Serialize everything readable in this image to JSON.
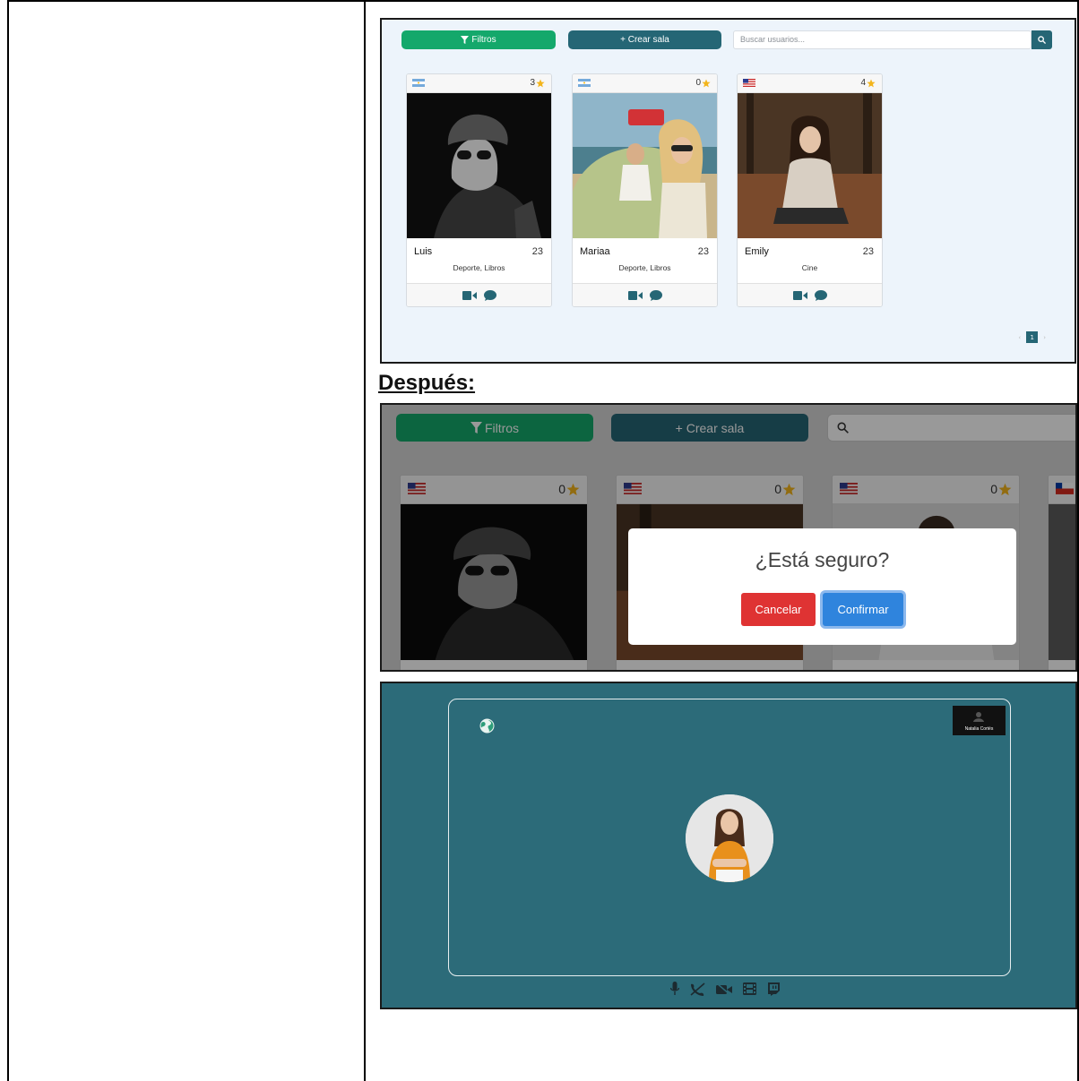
{
  "screenshot_before": {
    "filter_label": "Filtros",
    "create_room_label": "+ Crear sala",
    "search_placeholder": "Buscar usuarios...",
    "cards": [
      {
        "name": "Luis",
        "age": "23",
        "tags": "Deporte, Libros",
        "rating": "3",
        "flag": "argentina"
      },
      {
        "name": "Mariaa",
        "age": "23",
        "tags": "Deporte, Libros",
        "rating": "0",
        "flag": "argentina"
      },
      {
        "name": "Emily",
        "age": "23",
        "tags": "Cine",
        "rating": "4",
        "flag": "usa"
      }
    ],
    "pagination": {
      "current": "1"
    }
  },
  "section_label": "Después:",
  "screenshot_after": {
    "filter_label": "Filtros",
    "create_room_label": "+ Crear sala",
    "cards": [
      {
        "rating": "0",
        "flag": "usa"
      },
      {
        "rating": "0",
        "flag": "usa"
      },
      {
        "rating": "0",
        "flag": "usa"
      },
      {
        "rating": "",
        "flag": "chile"
      }
    ],
    "modal": {
      "title": "¿Está seguro?",
      "cancel_label": "Cancelar",
      "confirm_label": "Confirmar"
    }
  },
  "screenshot_call": {
    "self_tile_name": "Natalia Cortés",
    "controls": [
      "microphone-icon",
      "hangup-icon",
      "camera-off-icon",
      "film-icon",
      "twitch-icon"
    ]
  },
  "colors": {
    "green": "#14a86b",
    "teal": "#256675",
    "call_bg": "#2c6b79",
    "cancel": "#df3333",
    "confirm": "#2f84dd",
    "star": "#f3b51c"
  }
}
